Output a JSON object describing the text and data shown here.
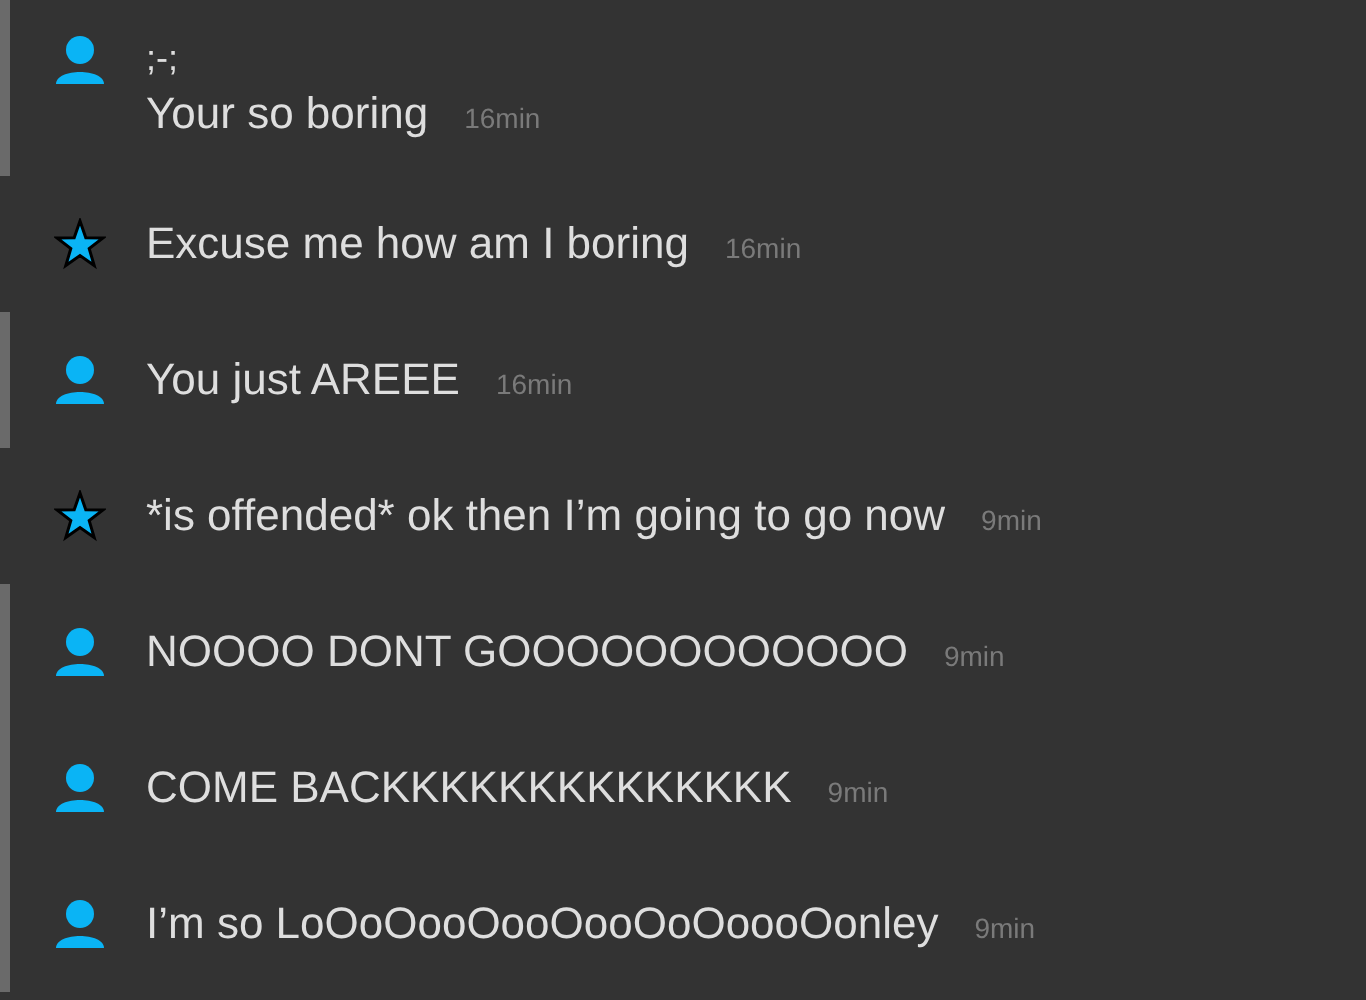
{
  "groups": [
    {
      "kind": "user",
      "messages": [
        {
          "lines": [
            ";-;",
            "Your so boring"
          ],
          "time": "16min"
        }
      ]
    },
    {
      "kind": "star",
      "messages": [
        {
          "lines": [
            "Excuse me how am I boring"
          ],
          "time": "16min"
        }
      ]
    },
    {
      "kind": "user",
      "messages": [
        {
          "lines": [
            "You just AREEE"
          ],
          "time": "16min"
        }
      ]
    },
    {
      "kind": "star",
      "messages": [
        {
          "lines": [
            "*is offended* ok then I’m going to go now"
          ],
          "time": "9min"
        }
      ]
    },
    {
      "kind": "user",
      "messages": [
        {
          "lines": [
            "NOOOO DONT GOOOOOOOOOOOO"
          ],
          "time": "9min"
        },
        {
          "lines": [
            "COME BACKKKKKKKKKKKKKK"
          ],
          "time": "9min"
        },
        {
          "lines": [
            "I’m so LoOoOooOooOooOoOoooOonley"
          ],
          "time": "9min"
        }
      ]
    }
  ]
}
